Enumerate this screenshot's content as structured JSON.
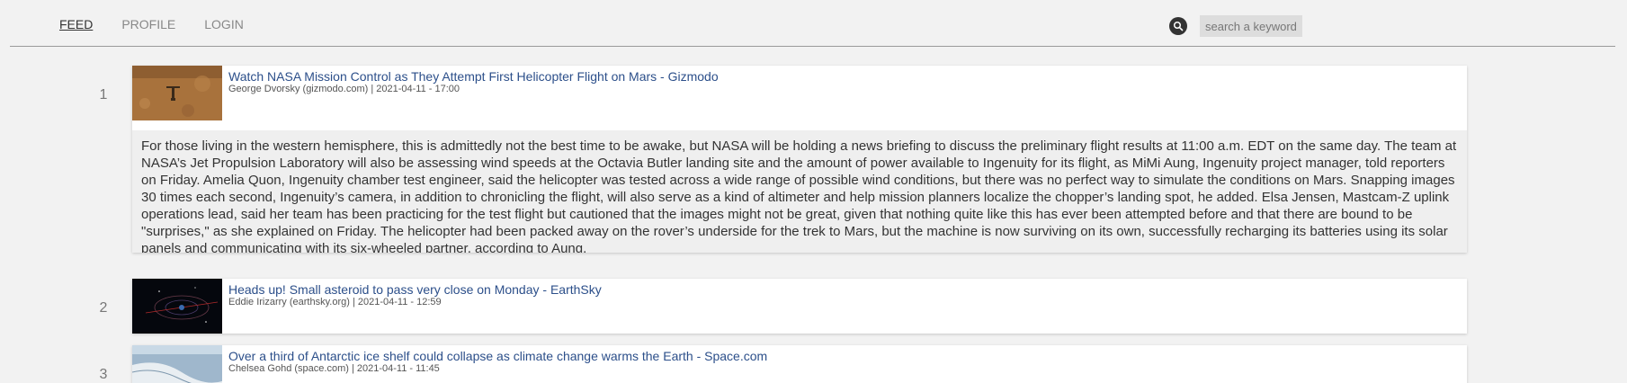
{
  "nav": {
    "items": [
      {
        "label": "FEED",
        "active": true
      },
      {
        "label": "PROFILE",
        "active": false
      },
      {
        "label": "LOGIN",
        "active": false
      }
    ]
  },
  "search": {
    "placeholder": "search a keyword",
    "icon": "search-icon"
  },
  "articles": [
    {
      "rank": "1",
      "title": "Watch NASA Mission Control as They Attempt First Helicopter Flight on Mars - Gizmodo",
      "meta": "George Dvorsky (gizmodo.com) | 2021-04-11 - 17:00",
      "expanded": true,
      "summary": "For those living in the western hemisphere, this is admittedly not the best time to be awake, but NASA will be holding a news briefing to discuss the preliminary flight results at 11:00 a.m. EDT on the same day. The team at NASA’s Jet Propulsion Laboratory will also be assessing wind speeds at the Octavia Butler landing site and the amount of power available to Ingenuity for its flight, as MiMi Aung, Ingenuity project manager, told reporters on Friday. Amelia Quon, Ingenuity chamber test engineer, said the helicopter was tested across a wide range of possible wind conditions, but there was no perfect way to simulate the conditions on Mars. Snapping images 30 times each second, Ingenuity’s camera, in addition to chronicling the flight, will also serve as a kind of altimeter and help mission planners localize the chopper’s landing spot, he added. Elsa Jensen, Mastcam-Z uplink operations lead, said her team has been practicing for the test flight but cautioned that the images might not be great, given that nothing quite like this has ever been attempted before and that there are bound to be \"surprises,\" as she explained on Friday. The helicopter had been packed away on the rover’s underside for the trek to Mars, but the machine is now surviving on its own, successfully recharging its batteries using its solar panels and communicating with its six-wheeled partner, according to Aung."
    },
    {
      "rank": "2",
      "title": "Heads up! Small asteroid to pass very close on Monday - EarthSky",
      "meta": "Eddie Irizarry (earthsky.org) | 2021-04-11 - 12:59",
      "expanded": false
    },
    {
      "rank": "3",
      "title": "Over a third of Antarctic ice shelf could collapse as climate change warms the Earth - Space.com",
      "meta": "Chelsea Gohd (space.com) | 2021-04-11 - 11:45",
      "expanded": false
    }
  ]
}
